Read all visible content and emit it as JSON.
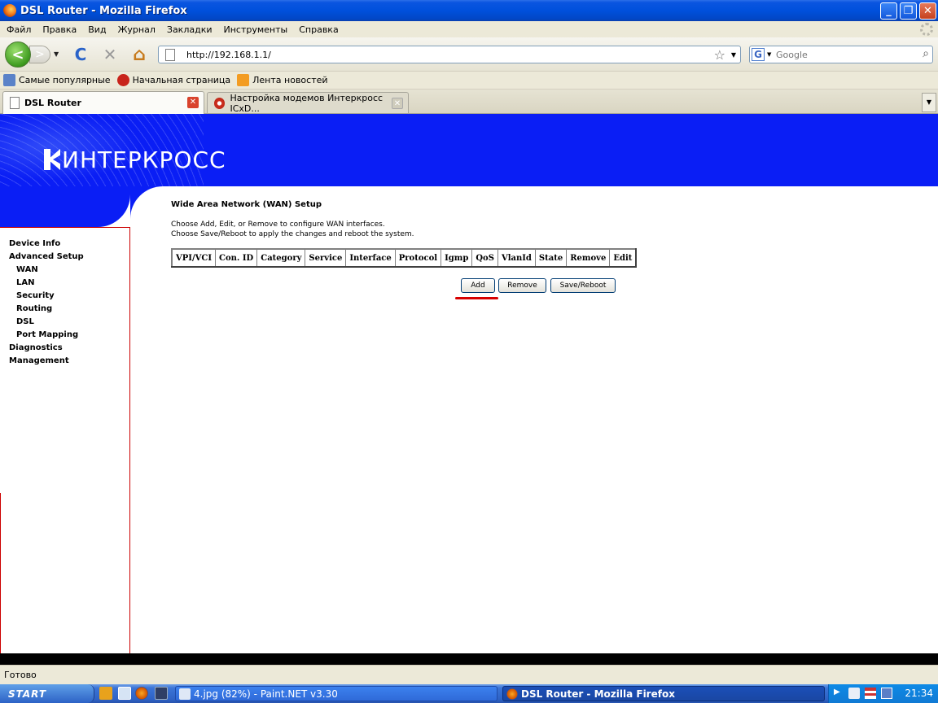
{
  "window": {
    "title": "DSL Router - Mozilla Firefox",
    "min": "_",
    "max": "❐",
    "close": "✕"
  },
  "menu": [
    "Файл",
    "Правка",
    "Вид",
    "Журнал",
    "Закладки",
    "Инструменты",
    "Справка"
  ],
  "toolbar": {
    "url": "http://192.168.1.1/",
    "search_placeholder": "Google",
    "reload": "C",
    "stop": "✕",
    "home": "⌂",
    "back": "<",
    "forward": ">",
    "engine": "G"
  },
  "bookmarks": [
    "Самые популярные",
    "Начальная страница",
    "Лента новостей"
  ],
  "tabs": [
    {
      "label": "DSL Router"
    },
    {
      "label": "Настройка модемов Интеркросс ICxD..."
    }
  ],
  "router": {
    "logo": "ИНТЕРКРОСС",
    "nav": {
      "device_info": "Device Info",
      "advanced_setup": "Advanced Setup",
      "wan": "WAN",
      "lan": "LAN",
      "security": "Security",
      "routing": "Routing",
      "dsl": "DSL",
      "port_mapping": "Port Mapping",
      "diagnostics": "Diagnostics",
      "management": "Management"
    },
    "heading": "Wide Area Network (WAN) Setup",
    "desc_line1": "Choose Add, Edit, or Remove to configure WAN interfaces.",
    "desc_line2": "Choose Save/Reboot to apply the changes and reboot the system.",
    "columns": [
      "VPI/VCI",
      "Con. ID",
      "Category",
      "Service",
      "Interface",
      "Protocol",
      "Igmp",
      "QoS",
      "VlanId",
      "State",
      "Remove",
      "Edit"
    ],
    "buttons": {
      "add": "Add",
      "remove": "Remove",
      "save_reboot": "Save/Reboot"
    },
    "banner_color": "#0a1ef5"
  },
  "status": "Готово",
  "taskbar": {
    "start": "START",
    "tasks": [
      "4.jpg (82%) - Paint.NET v3.30",
      "DSL Router - Mozilla Firefox"
    ],
    "clock": "21:34"
  }
}
